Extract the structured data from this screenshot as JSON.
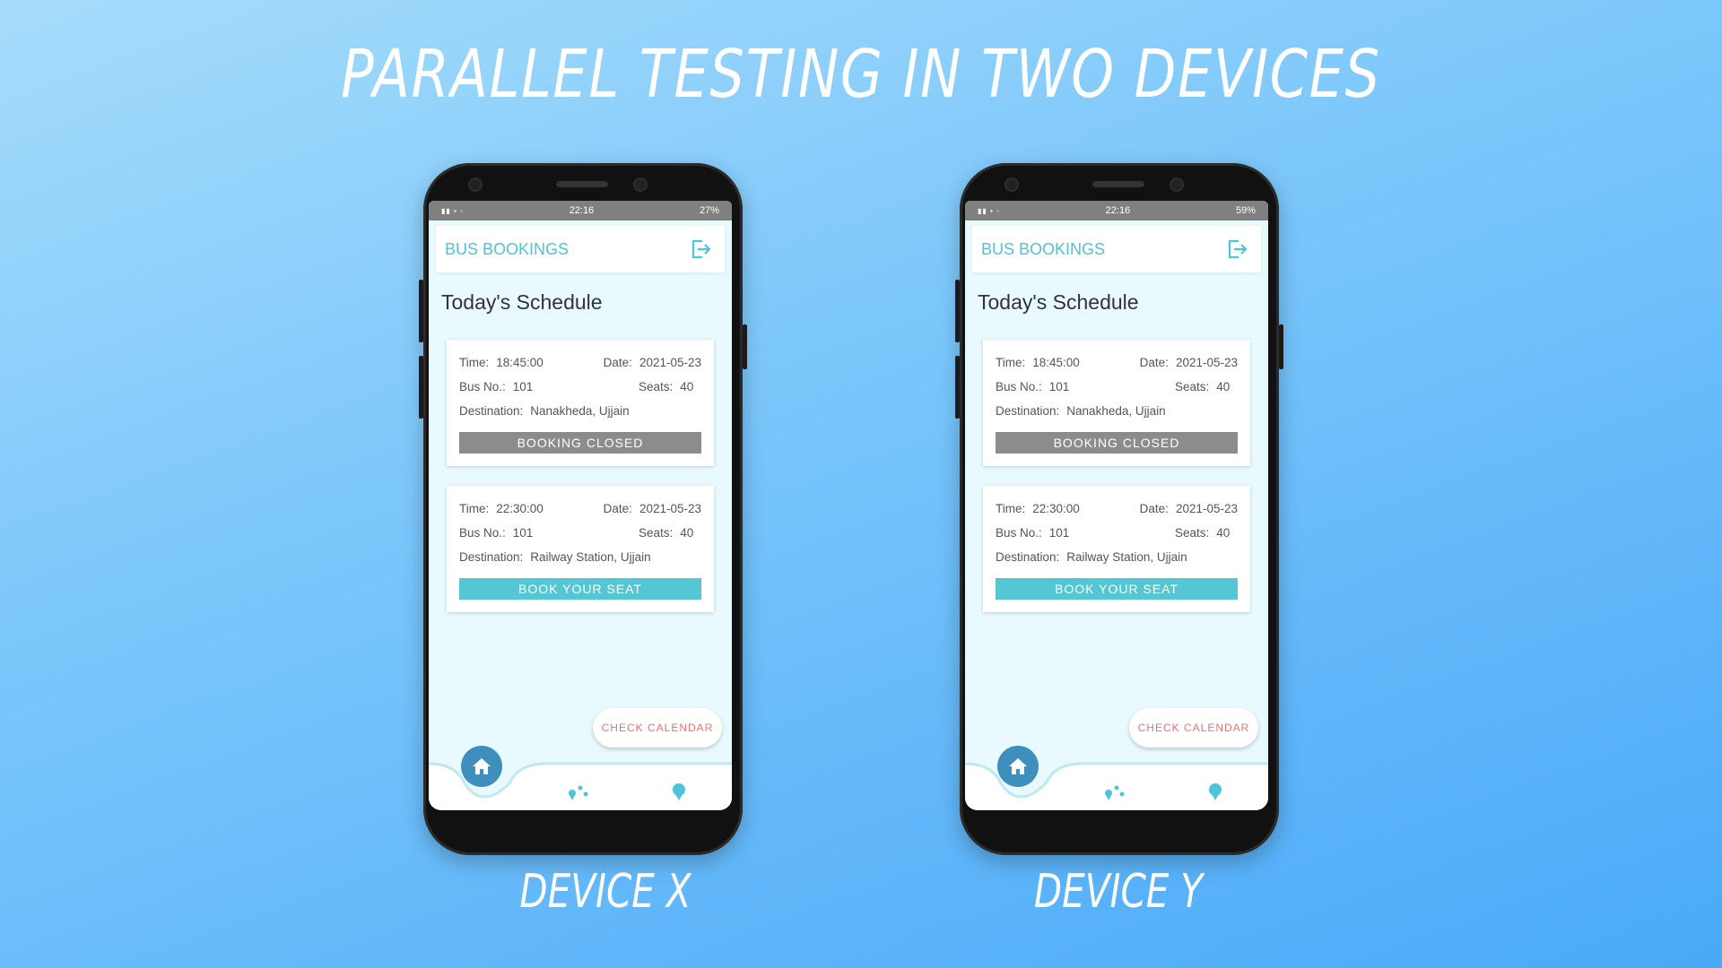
{
  "title": "PARALLEL TESTING IN TWO DEVICES",
  "colors": {
    "accent": "#4fc3d8",
    "closed": "#8c8c8c",
    "book": "#55c6d3",
    "calendar_text": "#e57373",
    "home": "#3e8fbd"
  },
  "devices": [
    {
      "label": "DEVICE X",
      "status_time": "22:16",
      "status_right": "27%",
      "app_title": "BUS BOOKINGS",
      "section_title": "Today's Schedule",
      "cards": [
        {
          "time_label": "Time:",
          "time": "18:45:00",
          "date_label": "Date:",
          "date": "2021-05-23",
          "bus_label": "Bus No.:",
          "bus": "101",
          "seats_label": "Seats:",
          "seats": "40",
          "dest_label": "Destination:",
          "destination": "Nanakheda, Ujjain",
          "button": "BOOKING CLOSED"
        },
        {
          "time_label": "Time:",
          "time": "22:30:00",
          "date_label": "Date:",
          "date": "2021-05-23",
          "bus_label": "Bus No.:",
          "bus": "101",
          "seats_label": "Seats:",
          "seats": "40",
          "dest_label": "Destination:",
          "destination": "Railway Station, Ujjain",
          "button": "BOOK YOUR SEAT"
        }
      ],
      "calendar_button": "CHECK CALENDAR",
      "icons": [
        "home-icon",
        "map-pins-icon",
        "support-icon",
        "logout-icon"
      ]
    },
    {
      "label": "DEVICE Y",
      "status_time": "22:16",
      "status_right": "59%",
      "app_title": "BUS BOOKINGS",
      "section_title": "Today's Schedule",
      "cards": [
        {
          "time_label": "Time:",
          "time": "18:45:00",
          "date_label": "Date:",
          "date": "2021-05-23",
          "bus_label": "Bus No.:",
          "bus": "101",
          "seats_label": "Seats:",
          "seats": "40",
          "dest_label": "Destination:",
          "destination": "Nanakheda, Ujjain",
          "button": "BOOKING CLOSED"
        },
        {
          "time_label": "Time:",
          "time": "22:30:00",
          "date_label": "Date:",
          "date": "2021-05-23",
          "bus_label": "Bus No.:",
          "bus": "101",
          "seats_label": "Seats:",
          "seats": "40",
          "dest_label": "Destination:",
          "destination": "Railway Station, Ujjain",
          "button": "BOOK YOUR SEAT"
        }
      ],
      "calendar_button": "CHECK CALENDAR",
      "icons": [
        "home-icon",
        "map-pins-icon",
        "support-icon",
        "logout-icon"
      ]
    }
  ]
}
